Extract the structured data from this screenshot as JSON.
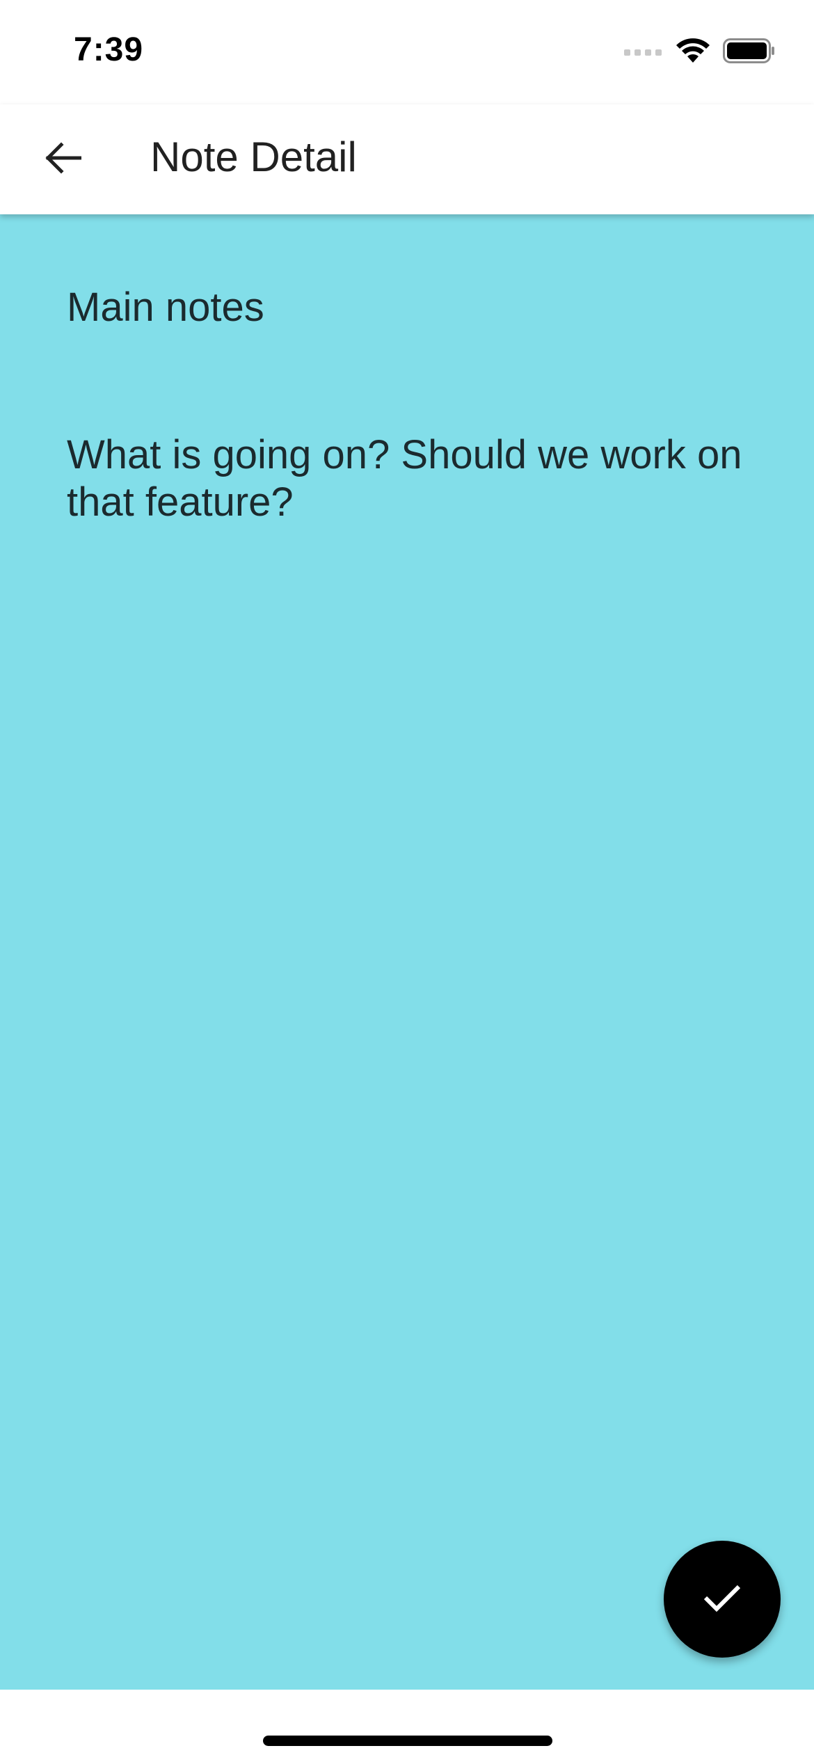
{
  "status_bar": {
    "time": "7:39"
  },
  "app_bar": {
    "title": "Note Detail",
    "back_icon": "arrow-back-icon"
  },
  "note": {
    "title": "Main notes",
    "body": "What is going on? Should we work on that feature?",
    "background_color": "#82dee9"
  },
  "fab": {
    "icon": "check-icon",
    "color": "#000000"
  }
}
